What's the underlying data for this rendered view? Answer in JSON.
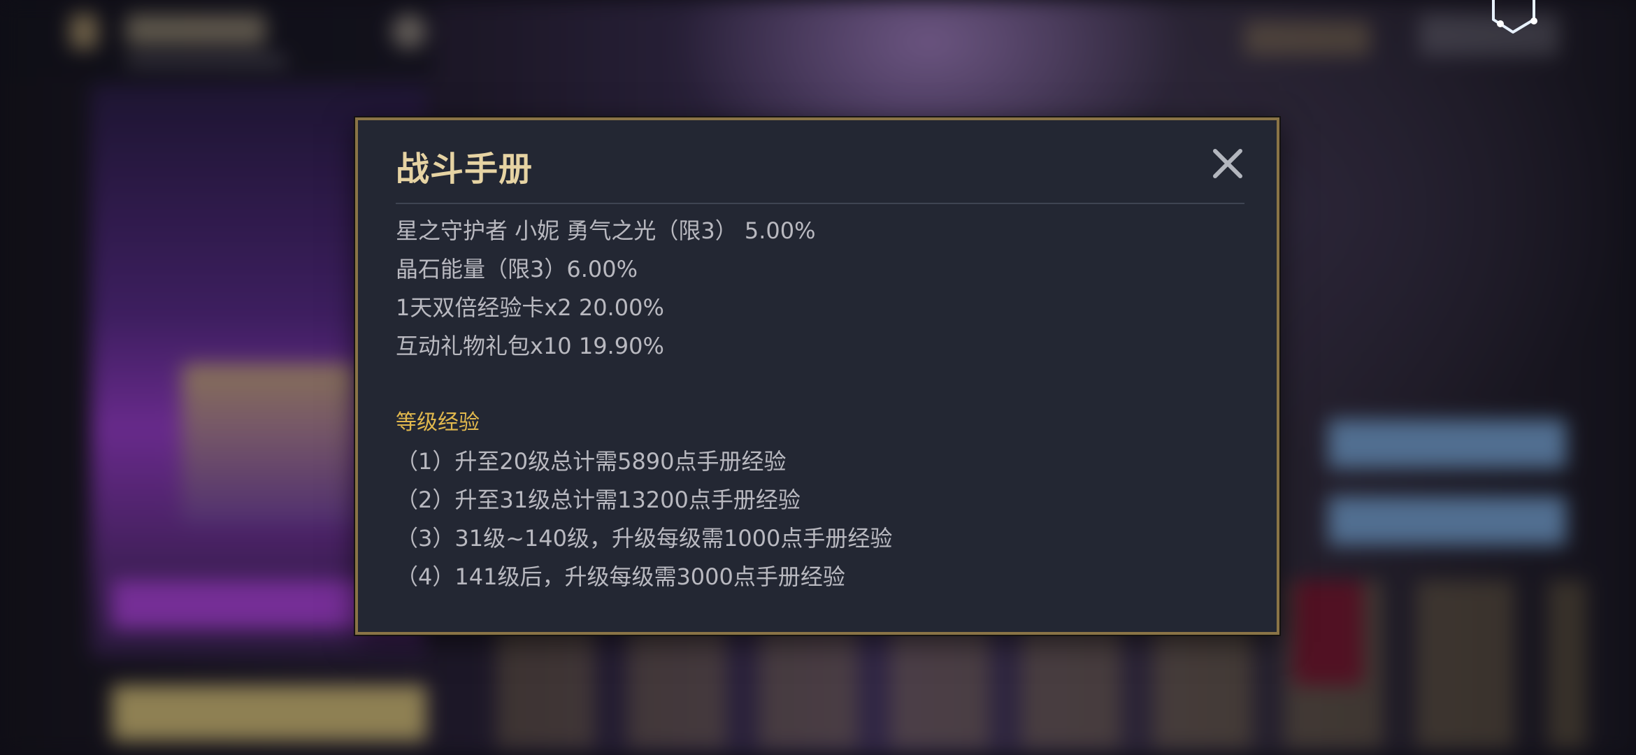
{
  "dialog": {
    "title": "战斗手册",
    "reward_lines": [
      "星之守护者 小妮 勇气之光（限3） 5.00%",
      "晶石能量（限3）6.00%",
      "1天双倍经验卡x2 20.00%",
      "互动礼物礼包x10 19.90%"
    ],
    "section_heading": "等级经验",
    "exp_lines": [
      "（1）升至20级总计需5890点手册经验",
      "（2）升至31级总计需13200点手册经验",
      "（3）31级~140级，升级每级需1000点手册经验",
      "（4）141级后，升级每级需3000点手册经验"
    ],
    "icons": {
      "close": "close-icon"
    }
  },
  "colors": {
    "title": "#e6d3a3",
    "heading": "#e1b84d",
    "body_text": "#b9b9c0",
    "modal_bg": "#232733",
    "modal_border": "#8a7446"
  }
}
